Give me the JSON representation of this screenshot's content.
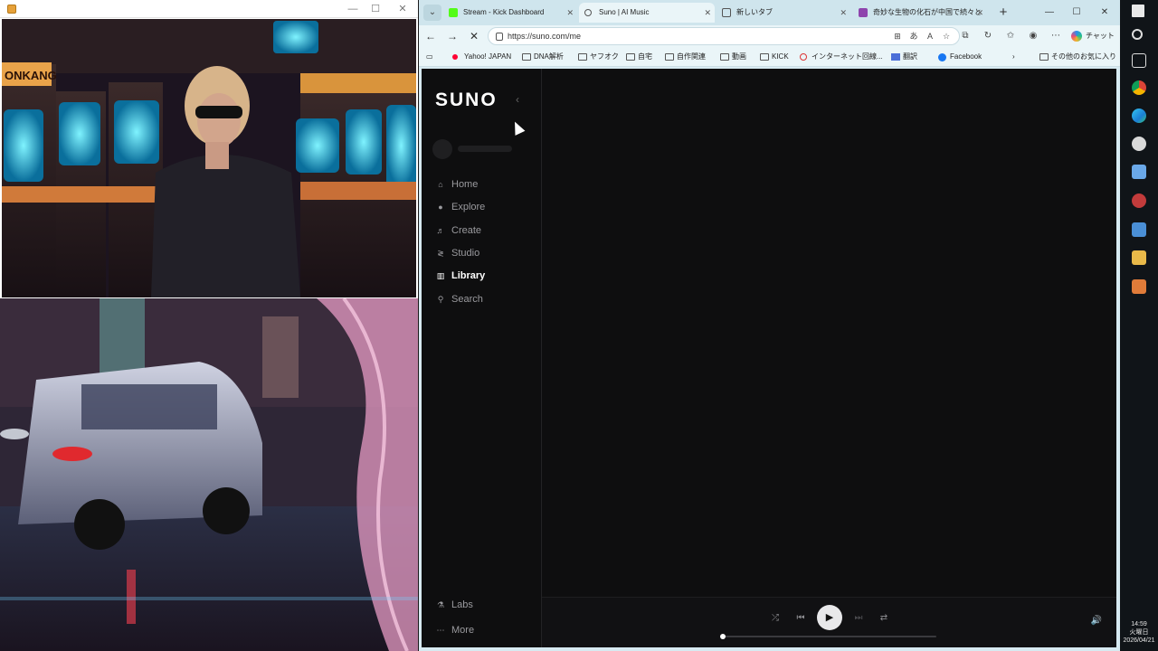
{
  "browser": {
    "tabs": [
      {
        "label": "Stream - Kick Dashboard",
        "favicon": "kick-icon",
        "color": "#53fc18",
        "active": false
      },
      {
        "label": "Suno | AI Music",
        "favicon": "loading-icon",
        "color": "#333333",
        "active": true
      },
      {
        "label": "新しいタブ",
        "favicon": "newtab-icon",
        "color": "#555555",
        "active": false
      },
      {
        "label": "奇妙な生物の化石が中国で続々と",
        "favicon": "news-icon",
        "color": "#8e44ad",
        "active": false
      }
    ],
    "url": "https://suno.com/me",
    "copilot_label": "チャット",
    "bookmarks": [
      "Yahoo! JAPAN",
      "DNA解析",
      "ヤフオク",
      "自宅",
      "自作関連",
      "動画",
      "KICK",
      "インターネット回線...",
      "翻訳",
      "Facebook"
    ],
    "other_bookmarks": "その他のお気に入り"
  },
  "suno": {
    "logo": "SUNO",
    "nav": [
      {
        "label": "Home",
        "icon": "home-icon",
        "active": false
      },
      {
        "label": "Explore",
        "icon": "explore-icon",
        "active": false
      },
      {
        "label": "Create",
        "icon": "create-icon",
        "active": false
      },
      {
        "label": "Studio",
        "icon": "studio-icon",
        "active": false
      },
      {
        "label": "Library",
        "icon": "library-icon",
        "active": true
      },
      {
        "label": "Search",
        "icon": "search-icon",
        "active": false
      }
    ],
    "bottom_nav": [
      {
        "label": "Labs",
        "icon": "labs-icon"
      },
      {
        "label": "More",
        "icon": "more-icon"
      }
    ],
    "player": {
      "progress": 0.0
    }
  },
  "taskbar": {
    "time": "14:59",
    "day": "火曜日",
    "date": "2026/04/21"
  },
  "colors": {
    "accent_bg": "#0e0e0f",
    "text_active": "#ffffff",
    "text_muted": "#9a9a9e"
  }
}
